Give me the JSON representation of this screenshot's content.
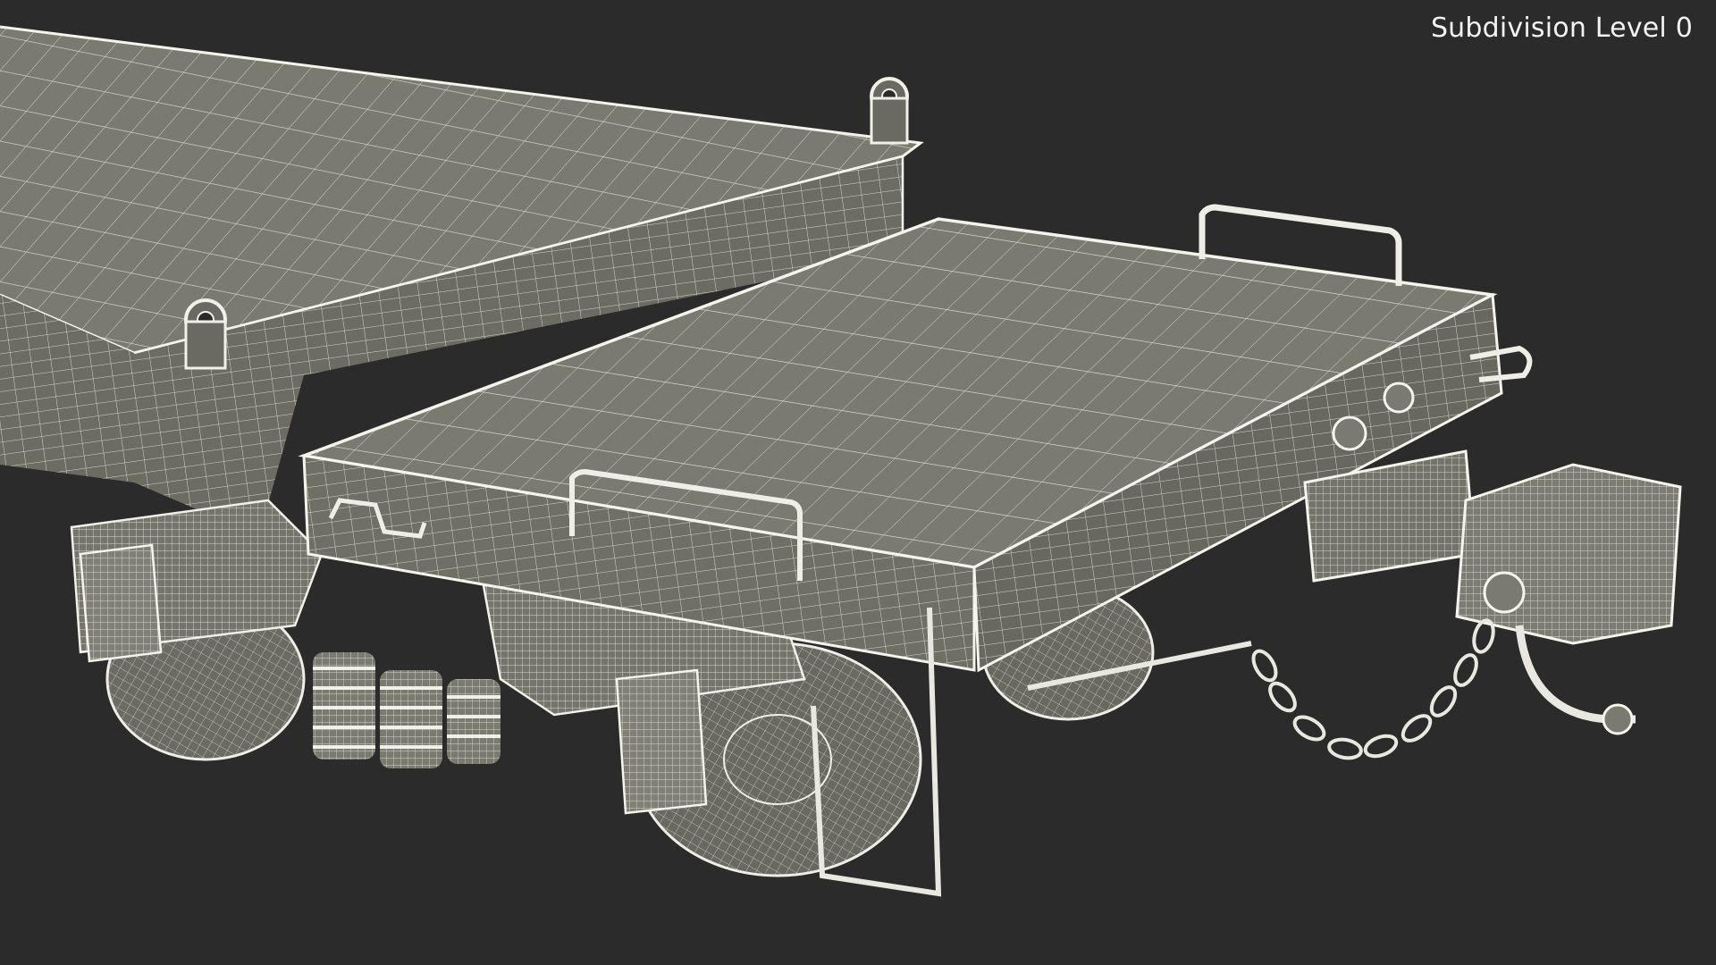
{
  "viewport": {
    "overlay_label": "Subdivision Level 0"
  },
  "colors": {
    "background": "#2b2b2b",
    "surface": "#7a7a70",
    "surface_dark": "#5e5e56",
    "wire": "#d9d9cf",
    "edge": "#f4f4ec"
  }
}
